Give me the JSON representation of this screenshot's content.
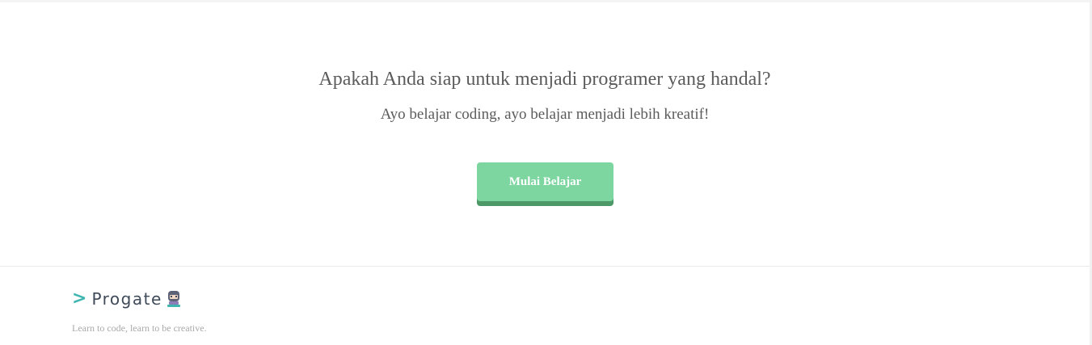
{
  "hero": {
    "title": "Apakah Anda siap untuk menjadi programer yang handal?",
    "subtitle": "Ayo belajar coding, ayo belajar menjadi lebih kreatif!",
    "cta_label": "Mulai Belajar"
  },
  "footer": {
    "logo_text": "Progate",
    "logo_chevron": ">",
    "tagline": "Learn to code, learn to be creative."
  },
  "colors": {
    "cta_background": "#7dd5a0",
    "cta_shadow": "#4c9867",
    "logo_chevron": "#3fb5b0",
    "logo_text": "#3f4a58",
    "body_text": "#5b5b5b",
    "tagline_text": "#a9a9a9"
  },
  "icons": {
    "logo_mascot": "ninja-mascot-icon"
  }
}
